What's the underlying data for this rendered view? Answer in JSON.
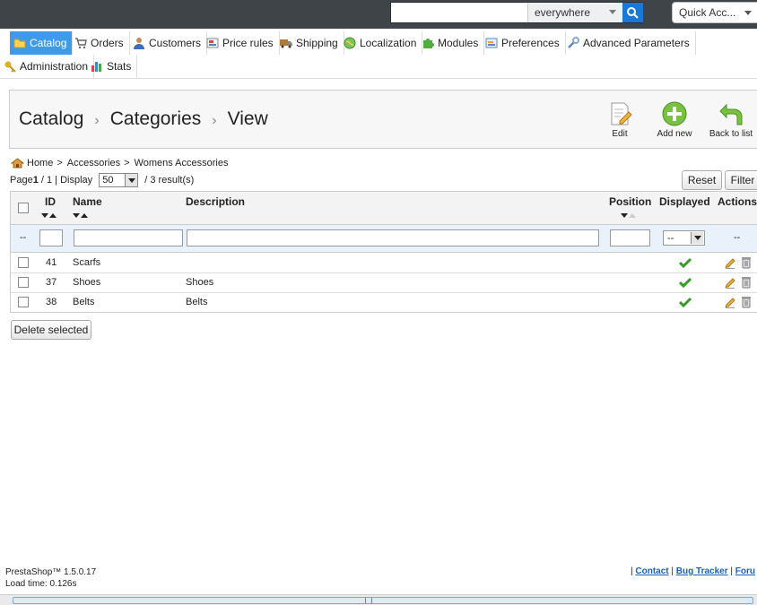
{
  "search": {
    "value": "",
    "scope": "everywhere"
  },
  "quick_access": "Quick Acc...",
  "tabs": [
    {
      "label": "Catalog",
      "icon": "folder-icon"
    },
    {
      "label": "Orders",
      "icon": "cart-icon"
    },
    {
      "label": "Customers",
      "icon": "user-icon"
    },
    {
      "label": "Price rules",
      "icon": "price-tag-icon"
    },
    {
      "label": "Shipping",
      "icon": "truck-icon"
    },
    {
      "label": "Localization",
      "icon": "globe-icon"
    },
    {
      "label": "Modules",
      "icon": "puzzle-icon"
    },
    {
      "label": "Preferences",
      "icon": "preferences-icon"
    },
    {
      "label": "Advanced Parameters",
      "icon": "wrench-icon"
    },
    {
      "label": "Administration",
      "icon": "key-icon"
    },
    {
      "label": "Stats",
      "icon": "bar-chart-icon"
    }
  ],
  "header": {
    "crumbs": [
      "Catalog",
      "Categories",
      "View"
    ],
    "separator": "›",
    "edit_label": "Edit",
    "add_new_label": "Add new",
    "back_label": "Back to list"
  },
  "path": {
    "home": "Home",
    "items": [
      "Accessories",
      "Womens Accessories"
    ],
    "separator": ">"
  },
  "paging": {
    "page_word": "Page",
    "page_current": "1",
    "page_rest": " / 1 | Display ",
    "display": "50",
    "results": " / 3 result(s)"
  },
  "buttons": {
    "reset": "Reset",
    "filter": "Filter",
    "delete_selected": "Delete selected"
  },
  "table": {
    "columns": {
      "id": "ID",
      "name": "Name",
      "description": "Description",
      "position": "Position",
      "displayed": "Displayed",
      "actions": "Actions"
    },
    "filter": {
      "first": "--",
      "displayed": "--",
      "actions": "--"
    },
    "rows": [
      {
        "id": "41",
        "name": "Scarfs",
        "description": "",
        "displayed": true
      },
      {
        "id": "37",
        "name": "Shoes",
        "description": "Shoes",
        "displayed": true
      },
      {
        "id": "38",
        "name": "Belts",
        "description": "Belts",
        "displayed": true
      }
    ]
  },
  "footer": {
    "version": "PrestaShop™ 1.5.0.17",
    "load_time": "Load time: 0.126s",
    "links": [
      "Contact",
      "Bug Tracker",
      "Foru"
    ],
    "divider": "|"
  },
  "colors": {
    "accent": "#3d9be9",
    "topbar": "#3f4448",
    "check": "#3a9a2c"
  }
}
